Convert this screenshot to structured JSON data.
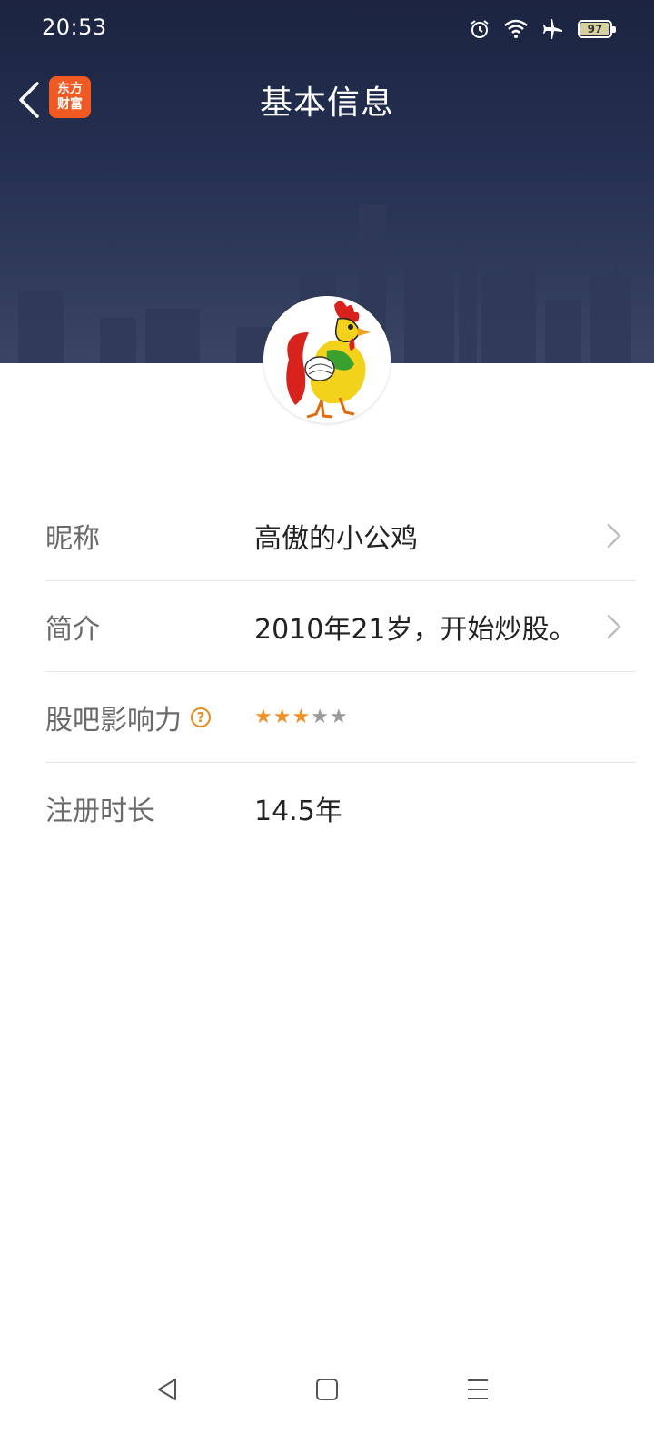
{
  "status_bar": {
    "time": "20:53",
    "battery_level": 97,
    "battery_label": "97",
    "icons": [
      "alarm-icon",
      "wifi-icon",
      "airplane-icon",
      "battery-icon"
    ]
  },
  "header": {
    "title": "基本信息",
    "logo_line1": "东方",
    "logo_line2": "财富",
    "logo_color": "#f05a22"
  },
  "profile": {
    "rows": [
      {
        "label": "昵称",
        "value": "高傲的小公鸡",
        "has_arrow": true
      },
      {
        "label": "简介",
        "value": "2010年21岁，开始炒股。",
        "has_arrow": true
      },
      {
        "label": "股吧影响力",
        "rating": 3,
        "rating_max": 5,
        "help_symbol": "?"
      },
      {
        "label": "注册时长",
        "value": "14.5年"
      }
    ]
  },
  "colors": {
    "accent": "#f0922a",
    "header_bg": "#253052"
  },
  "system_nav": [
    "back-icon",
    "home-icon",
    "recents-icon"
  ]
}
